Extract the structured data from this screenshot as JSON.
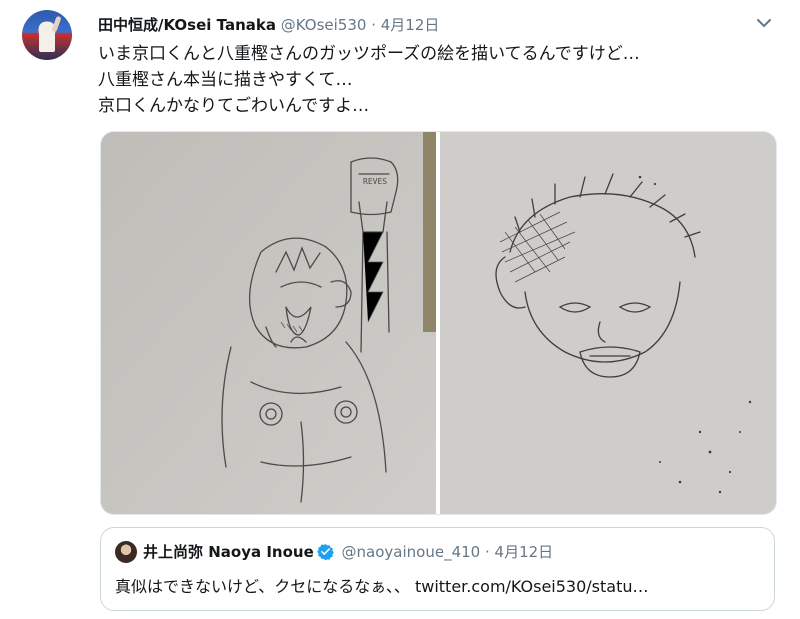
{
  "tweet": {
    "display_name": "田中恒成/KOsei Tanaka",
    "handle": "@KOsei530",
    "separator": "·",
    "date": "4月12日",
    "lines": [
      "いま京口くんと八重樫さんのガッツポーズの絵を描いてるんですけど…",
      "八重樫さん本当に描きやすくて…",
      "京口くんかなりてごわいんですよ…"
    ],
    "menu_icon": "chevron-down-icon"
  },
  "media": {
    "left_sketch_text": "REVES"
  },
  "quote": {
    "display_name": "井上尚弥 Naoya Inoue",
    "verified_icon": "verified-badge-icon",
    "handle": "@naoyainoue_410",
    "separator": "·",
    "date": "4月12日",
    "text": "真似はできないけど、クセになるなぁ、、 twitter.com/KOsei530/statu…"
  },
  "colors": {
    "text": "#14171a",
    "secondary": "#657786",
    "verified": "#1da1f2",
    "border": "#ccd6dd"
  }
}
